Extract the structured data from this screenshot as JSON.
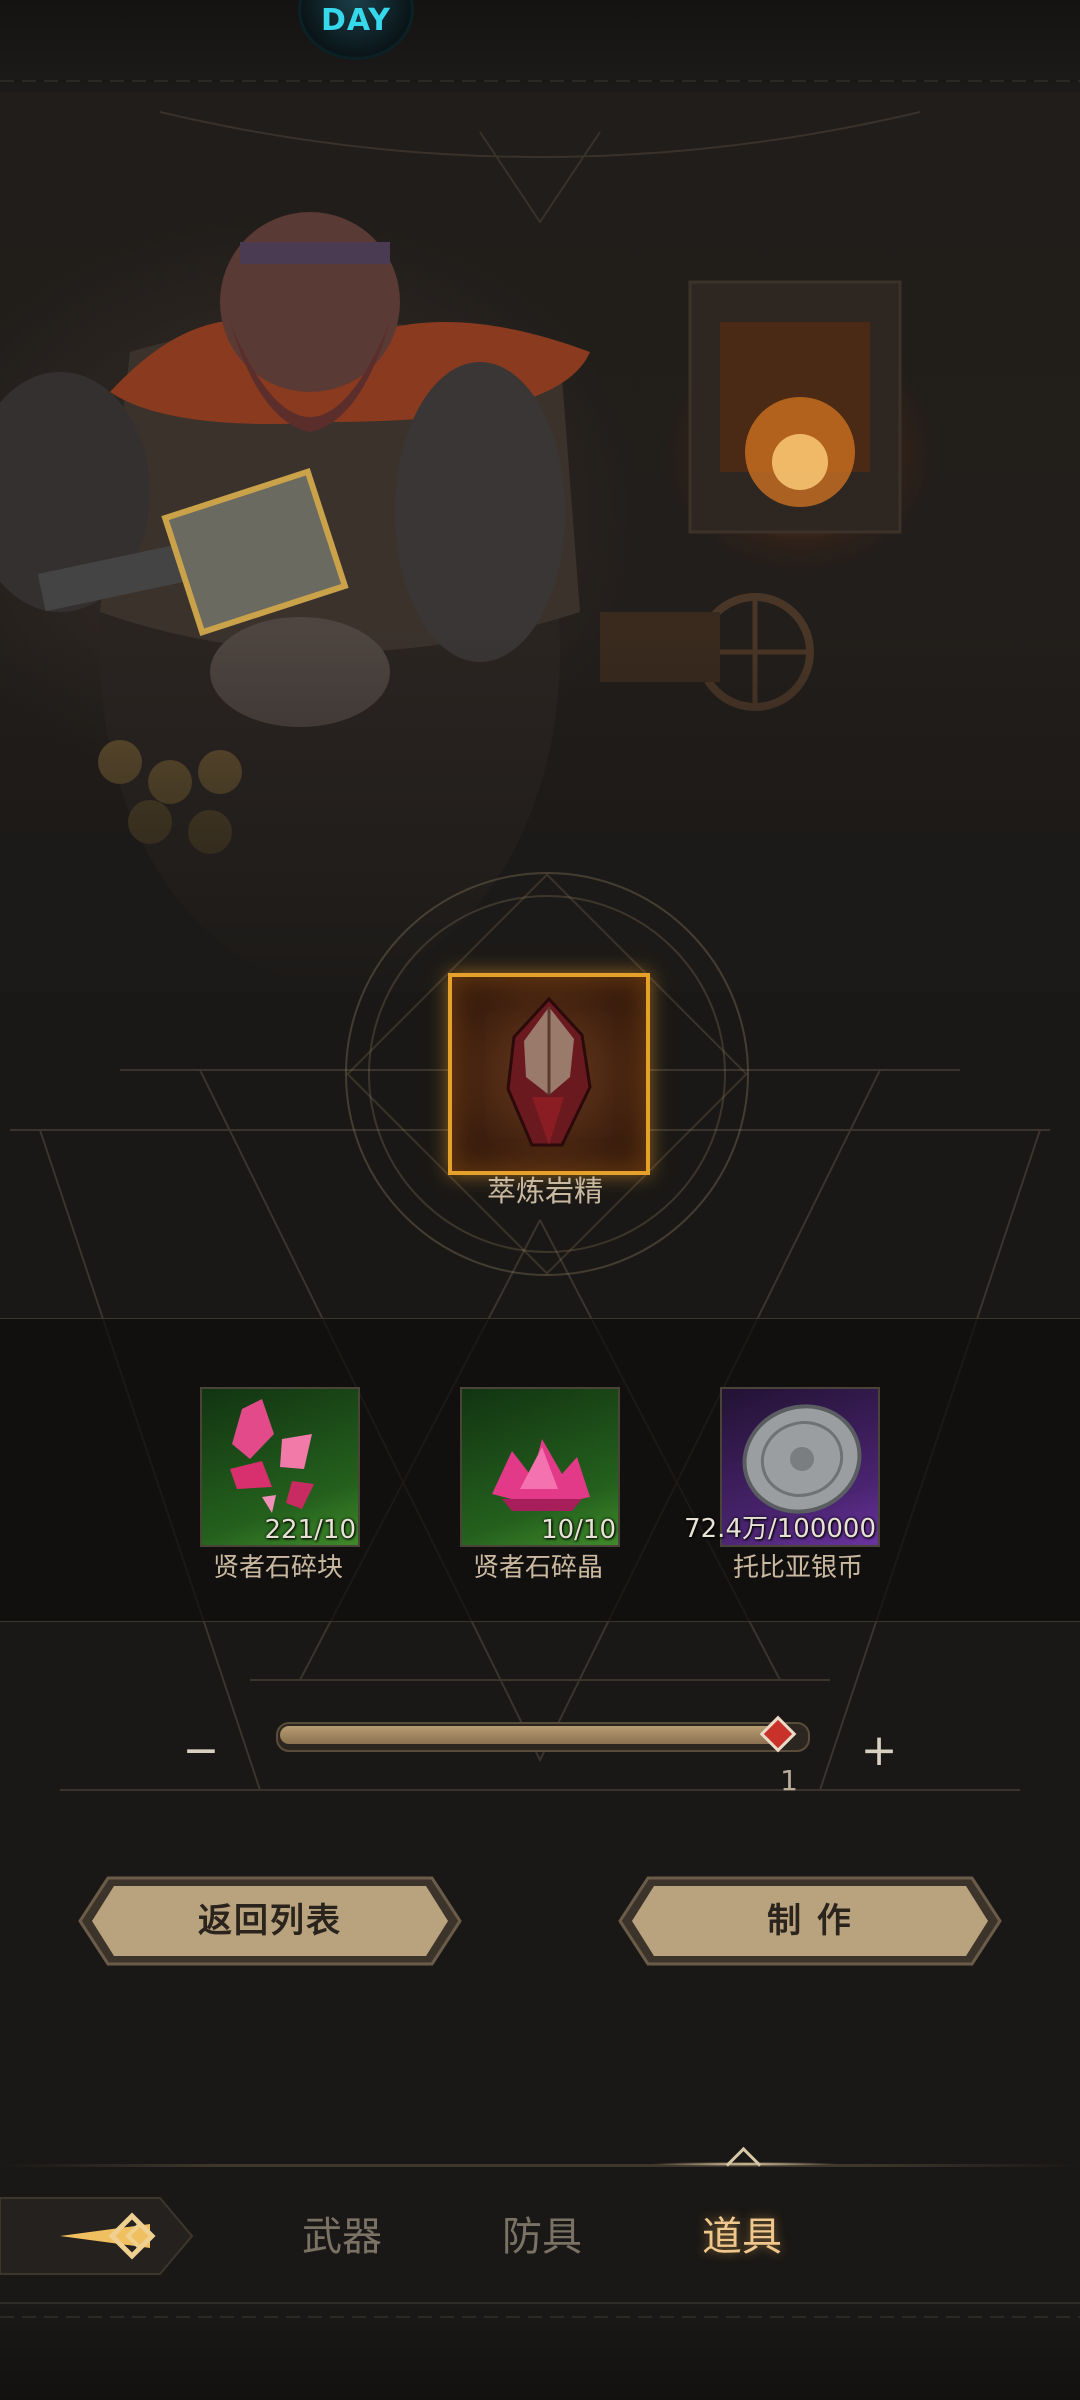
{
  "top_badge": {
    "text": "DAY"
  },
  "crafted_item": {
    "name": "萃炼岩精",
    "rarity_color": "#e6a12a"
  },
  "materials": [
    {
      "name": "贤者石碎块",
      "count": "221/10",
      "rarity_color": "#3f8a2a",
      "icon": "gem-shards-icon"
    },
    {
      "name": "贤者石碎晶",
      "count": "10/10",
      "rarity_color": "#3f8a2a",
      "icon": "gem-crystal-cluster-icon"
    },
    {
      "name": "托比亚银币",
      "count": "72.4万/100000",
      "rarity_color": "#6b33a0",
      "icon": "silver-coin-icon"
    }
  ],
  "quantity": {
    "minus_label": "−",
    "plus_label": "+",
    "value": "1",
    "fill_fraction": 1.0
  },
  "buttons": {
    "back_label": "返回列表",
    "craft_label": "制 作"
  },
  "nav": {
    "back_icon": "back-arrow-icon",
    "tabs": [
      {
        "label": "武器",
        "active": false
      },
      {
        "label": "防具",
        "active": false
      },
      {
        "label": "道具",
        "active": true
      }
    ]
  },
  "colors": {
    "accent": "#f0c78c",
    "button_fill": "#b9a27e",
    "background": "#1a1816"
  }
}
